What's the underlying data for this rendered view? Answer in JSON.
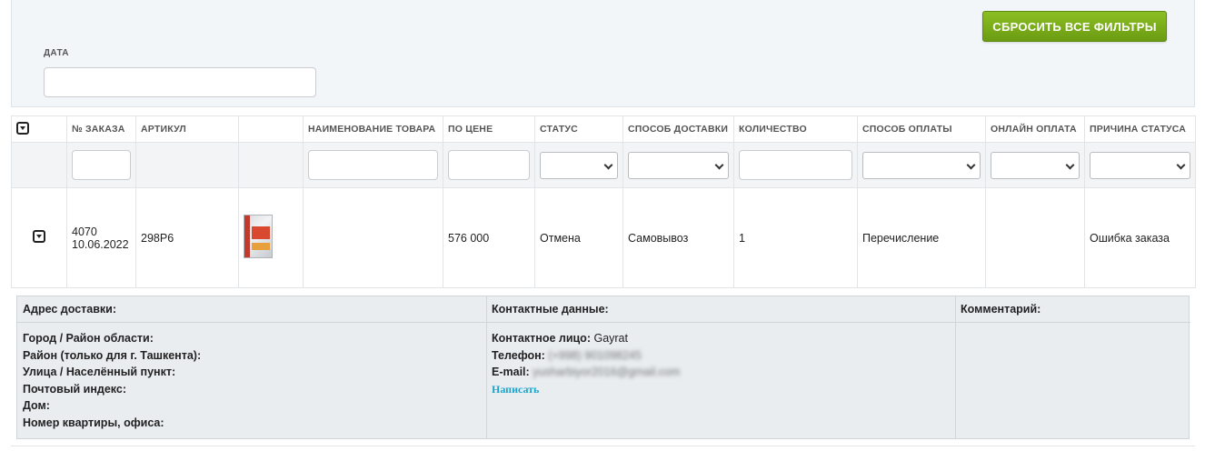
{
  "filters": {
    "reset_button": "СБРОСИТЬ ВСЕ ФИЛЬТРЫ",
    "date_label": "ДАТА",
    "date_value": ""
  },
  "table": {
    "headers": [
      "№ ЗАКАЗА",
      "АРТИКУЛ",
      "",
      "НАИМЕНОВАНИЕ ТОВАРА",
      "ПО ЦЕНЕ",
      "СТАТУС",
      "СПОСОБ ДОСТАВКИ",
      "КОЛИЧЕСТВО",
      "СПОСОБ ОПЛАТЫ",
      "ОНЛАЙН ОПЛАТА",
      "ПРИЧИНА СТАТУСА"
    ],
    "row": {
      "order_number": "4070",
      "order_date": "10.06.2022",
      "article": "298Р6",
      "product_name": "",
      "price": "576 000",
      "status": "Отмена",
      "delivery": "Самовывоз",
      "quantity": "1",
      "payment": "Перечисление",
      "online_payment": "",
      "status_reason": "Ошибка заказа"
    }
  },
  "details": {
    "address_title": "Адрес доставки:",
    "address_fields": [
      "Город / Район области:",
      "Район (только для г. Ташкента):",
      "Улица / Населённый пункт:",
      "Почтовый индекс:",
      "Дом:",
      "Номер квартиры, офиса:"
    ],
    "contact_title": "Контактные данные:",
    "contact_person_label": "Контактное лицо:",
    "contact_person": "Gayrat",
    "phone_label": "Телефон:",
    "phone": "(+998) 901098245",
    "email_label": "E-mail:",
    "email": "yusharbiyor2016@gmail.com",
    "write_link": "Написать",
    "comment_title": "Комментарий:"
  },
  "colors": {
    "reset_button": "#7aad19",
    "link": "#1aa3cc",
    "panel_bg": "#f3f6f8"
  }
}
